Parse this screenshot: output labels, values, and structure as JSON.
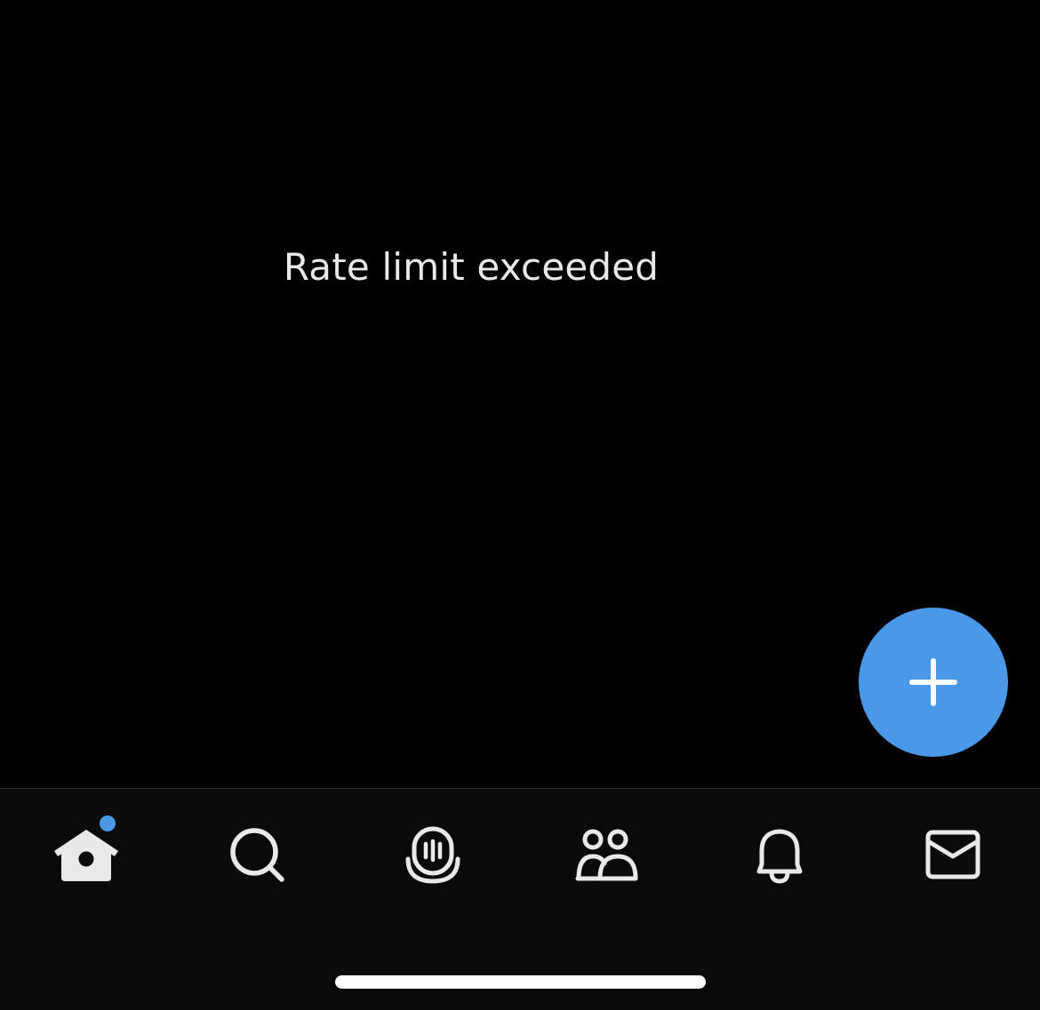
{
  "main": {
    "error_message": "Rate limit exceeded"
  },
  "fab": {
    "icon": "plus-icon",
    "color": "#4a99e9"
  },
  "tabbar": {
    "background": "#0a0a0a",
    "icon_color": "#e7e9ea",
    "tabs": [
      {
        "name": "home",
        "icon": "home-icon",
        "selected": true,
        "unread_dot": true
      },
      {
        "name": "search",
        "icon": "search-icon",
        "selected": false
      },
      {
        "name": "spaces",
        "icon": "spaces-microphone-icon",
        "selected": false
      },
      {
        "name": "communities",
        "icon": "communities-icon",
        "selected": false
      },
      {
        "name": "notifications",
        "icon": "bell-icon",
        "selected": false
      },
      {
        "name": "messages",
        "icon": "envelope-icon",
        "selected": false
      }
    ]
  },
  "accent_color": "#4a99e9"
}
